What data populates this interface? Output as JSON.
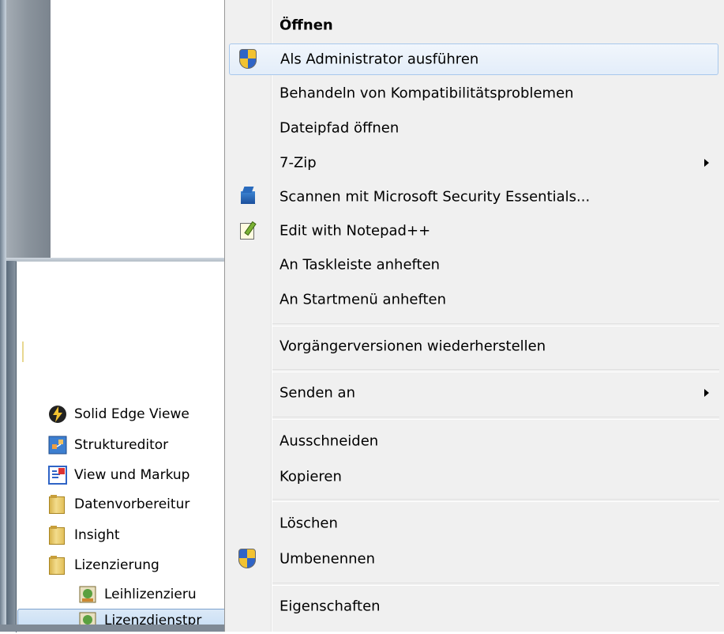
{
  "start_menu": {
    "items": [
      {
        "label": "Solid Edge Viewe",
        "icon": "solid-edge-viewer-icon",
        "color": "#f2c231"
      },
      {
        "label": "Struktureditor",
        "icon": "structure-editor-icon",
        "color": "#e0803a"
      },
      {
        "label": "View und Markup",
        "icon": "view-and-markup-icon",
        "color": "#2f64c6"
      },
      {
        "label": "Datenvorbereitur",
        "icon": "folder-icon"
      },
      {
        "label": "Insight",
        "icon": "folder-icon"
      },
      {
        "label": "Lizenzierung",
        "icon": "folder-icon"
      },
      {
        "label": "Leihlizenzieru",
        "icon": "license-tool-icon"
      },
      {
        "label": "Lizenzdienstpr",
        "icon": "license-service-icon"
      }
    ]
  },
  "context_menu": {
    "items": [
      {
        "label": "Öffnen",
        "bold": true
      },
      {
        "label": "Als Administrator ausführen",
        "icon": "uac-shield-icon"
      },
      {
        "label": "Behandeln von Kompatibilitätsproblemen"
      },
      {
        "label": "Dateipfad öffnen"
      },
      {
        "label": "7-Zip",
        "submenu": true
      },
      {
        "label": "Scannen mit Microsoft Security Essentials...",
        "icon": "security-essentials-icon"
      },
      {
        "label": "Edit with Notepad++",
        "icon": "notepad-plus-plus-icon"
      },
      {
        "label": "An Taskleiste anheften"
      },
      {
        "label": "An Startmenü anheften"
      },
      {
        "label": "Vorgängerversionen wiederherstellen"
      },
      {
        "label": "Senden an",
        "submenu": true
      },
      {
        "label": "Ausschneiden"
      },
      {
        "label": "Kopieren"
      },
      {
        "label": "Löschen"
      },
      {
        "label": "Umbenennen",
        "icon": "uac-shield-icon"
      },
      {
        "label": "Eigenschaften"
      }
    ]
  }
}
